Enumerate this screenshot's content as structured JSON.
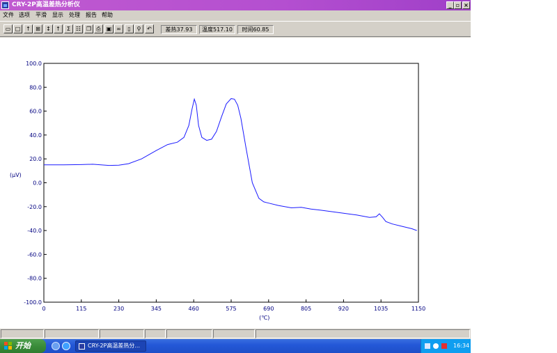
{
  "window": {
    "title": "CRY-2P高温差热分析仪",
    "minimize_glyph": "_",
    "restore_glyph": "▫",
    "close_glyph": "×"
  },
  "menu": [
    "文件",
    "选项",
    "平滑",
    "显示",
    "处理",
    "报告",
    "帮助"
  ],
  "toolbar": {
    "buttons": [
      {
        "icon": "open-folder-icon",
        "glyph": "▭"
      },
      {
        "icon": "window-icon",
        "glyph": "□"
      },
      {
        "icon": "arrow-up-icon",
        "glyph": "↑"
      },
      {
        "icon": "chart-icon",
        "glyph": "⊞"
      },
      {
        "icon": "arrow-up-down-icon",
        "glyph": "↕"
      },
      {
        "icon": "arrow-up-alt-icon",
        "glyph": "↑"
      },
      {
        "icon": "sigma-icon",
        "glyph": "Σ"
      },
      {
        "icon": "grid-icon",
        "glyph": "☷"
      },
      {
        "icon": "copy-icon",
        "glyph": "❐"
      },
      {
        "icon": "print-icon",
        "glyph": "⎙"
      },
      {
        "icon": "save-icon",
        "glyph": "▣"
      },
      {
        "icon": "binoculars-icon",
        "glyph": "∞"
      },
      {
        "icon": "page-icon",
        "glyph": "▯"
      },
      {
        "icon": "zoom-icon",
        "glyph": "⚲"
      },
      {
        "icon": "undo-icon",
        "glyph": "↶"
      }
    ],
    "readouts": {
      "diff_heat": "差热37.93",
      "temperature": "温度517.10",
      "time": "时间60.85"
    }
  },
  "chart_data": {
    "type": "line",
    "xlabel": "(℃)",
    "ylabel": "(μV)",
    "xlim": [
      0,
      1150
    ],
    "ylim": [
      -100,
      100
    ],
    "x_ticks": [
      "0",
      "115",
      "230",
      "345",
      "460",
      "575",
      "690",
      "805",
      "920",
      "1035",
      "1150"
    ],
    "y_ticks": [
      "100.0",
      "80.0",
      "60.0",
      "40.0",
      "20.0",
      "0.0",
      "-20.0",
      "-40.0",
      "-60.0",
      "-80.0",
      "-100.0"
    ],
    "grid": false,
    "color": "#1a1aff",
    "series": [
      {
        "x": [
          0,
          60,
          115,
          150,
          200,
          230,
          260,
          300,
          345,
          380,
          410,
          430,
          445,
          455,
          462,
          468,
          475,
          485,
          500,
          515,
          530,
          545,
          560,
          575,
          585,
          595,
          605,
          620,
          640,
          660,
          675,
          690,
          720,
          760,
          790,
          820,
          850,
          880,
          920,
          960,
          1000,
          1020,
          1030,
          1040,
          1050,
          1070,
          1100,
          1130,
          1145
        ],
        "y": [
          15,
          15,
          15.2,
          15.5,
          14.5,
          14.7,
          16,
          20,
          27,
          32,
          34,
          38,
          48,
          62,
          70,
          65,
          48,
          38,
          35.5,
          36.5,
          43,
          55,
          66,
          70.5,
          70,
          65,
          54,
          30,
          0,
          -13,
          -16,
          -17,
          -19,
          -21,
          -20.5,
          -22,
          -23,
          -24,
          -25.5,
          -27,
          -29,
          -28.5,
          -26,
          -29,
          -32.5,
          -34.5,
          -36.5,
          -38.5,
          -40
        ]
      }
    ]
  },
  "taskbar": {
    "start_label": "开始",
    "task_label": "CRY-2P高温差热分...",
    "clock": "16:34"
  }
}
